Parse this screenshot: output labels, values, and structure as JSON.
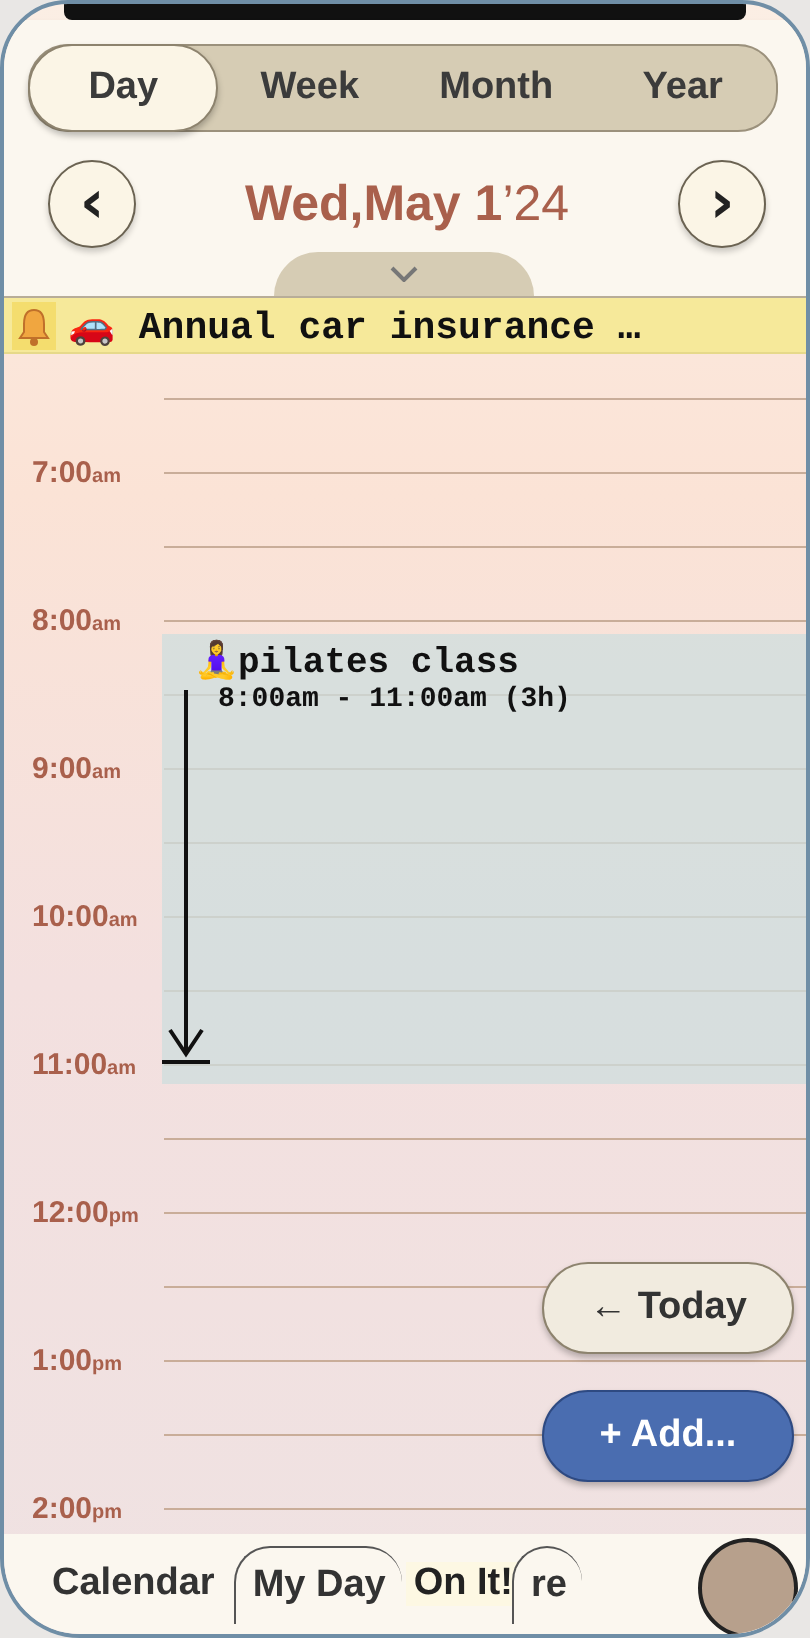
{
  "view_tabs": [
    {
      "label": "Day",
      "selected": true
    },
    {
      "label": "Week",
      "selected": false
    },
    {
      "label": "Month",
      "selected": false
    },
    {
      "label": "Year",
      "selected": false
    }
  ],
  "date_nav": {
    "prev": "‹",
    "next": "›",
    "date": "Wed,May 1",
    "year": "’24"
  },
  "all_day_banner": {
    "text": "🚗 Annual car insurance …"
  },
  "hours": [
    {
      "time": "7:00",
      "period": "am"
    },
    {
      "time": "8:00",
      "period": "am"
    },
    {
      "time": "9:00",
      "period": "am"
    },
    {
      "time": "10:00",
      "period": "am"
    },
    {
      "time": "11:00",
      "period": "am"
    },
    {
      "time": "12:00",
      "period": "pm"
    },
    {
      "time": "1:00",
      "period": "pm"
    },
    {
      "time": "2:00",
      "period": "pm"
    }
  ],
  "event": {
    "title": "🧘‍♀️pilates class",
    "time": "8:00am - 11:00am (3h)"
  },
  "today_button": "← Today",
  "add_button": "+ Add...",
  "bottom_tabs": [
    {
      "label": "Calendar",
      "selected": true
    },
    {
      "label": "My Day",
      "selected": false
    },
    {
      "label": "re",
      "selected": false
    }
  ],
  "on_it_badge": "On It!"
}
